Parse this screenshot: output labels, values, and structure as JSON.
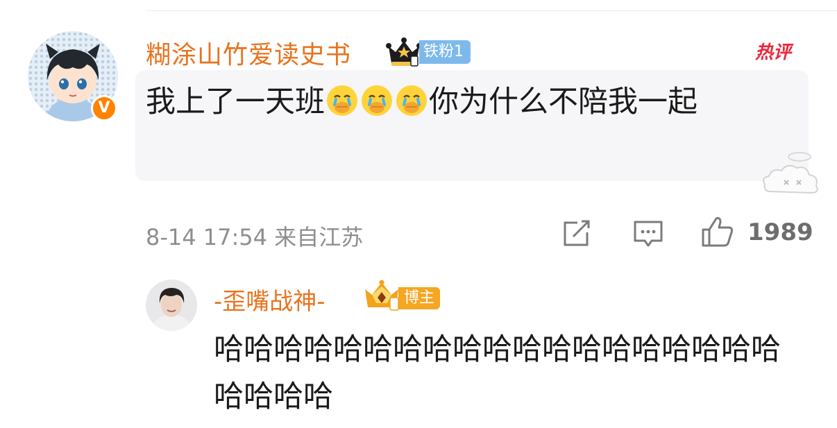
{
  "comment": {
    "username": "糊涂山竹爱读史书",
    "fan_badge": "铁粉1",
    "hot_label": "热评",
    "text_part1": "我上了一天班",
    "text_part2": "你为什么不陪我一起",
    "emoji_icon": "crying-face-emoji",
    "verified_icon": "V",
    "meta": "8-14 17:54 来自江苏",
    "like_count": "1989"
  },
  "reply": {
    "username": "-歪嘴战神-",
    "badge": "博主",
    "text": "哈哈哈哈哈哈哈哈哈哈哈哈哈哈哈哈哈哈哈哈哈哈哈"
  },
  "colors": {
    "username": "#e8731f",
    "verified": "#ff8200",
    "fan_badge": "#7eb9ec",
    "hot": "#e8283d",
    "blogger_badge": "#f5a623"
  }
}
